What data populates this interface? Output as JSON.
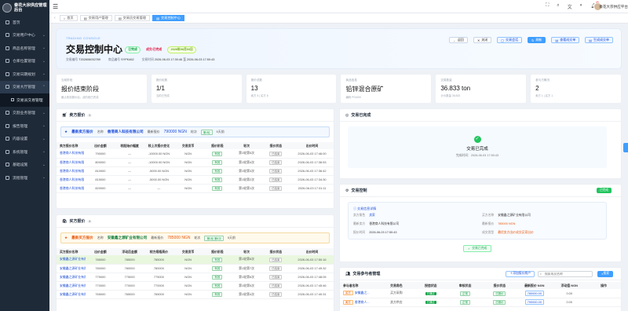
{
  "sidebar": {
    "brand": "秦花大宗供应管理后台",
    "items": [
      {
        "label": "首页",
        "arrow": ""
      },
      {
        "label": "交易用户中心",
        "arrow": "⌄"
      },
      {
        "label": "商品名称管理",
        "arrow": "⌄"
      },
      {
        "label": "仓库位置管理",
        "arrow": "⌄"
      },
      {
        "label": "交易日期规划",
        "arrow": "⌄"
      },
      {
        "label": "交易大厅管理",
        "arrow": "⌃"
      }
    ],
    "sub_item": "交易员交易管理",
    "items2": [
      {
        "label": "交割业务管理",
        "arrow": "⌄"
      },
      {
        "label": "报告管理",
        "arrow": "⌄"
      },
      {
        "label": "内容设置",
        "arrow": "⌄"
      },
      {
        "label": "系统管理",
        "arrow": "⌄"
      },
      {
        "label": "基础设施",
        "arrow": "⌄"
      },
      {
        "label": "流程管理",
        "arrow": "⌄"
      }
    ]
  },
  "topbar": {
    "username": "秦花大宗供应平台",
    "notif_count": "9"
  },
  "tabs": [
    "首页",
    "交易用户管理",
    "交易员交易管理",
    "交易控制中心"
  ],
  "hero": {
    "eyebrow": "TRADING CONSOLE",
    "title": "交易控制中心",
    "status": "已完成",
    "pill2": "成交/已完成",
    "pill3": "2026年06月03日",
    "order_label": "交易编号",
    "order_no": "T202606032789",
    "product_label": "商品编号",
    "product_no": "SYPK462",
    "time_label": "交易时间",
    "time_range": "2026-06-03 17:30:46 至 2026-06-03 17:50:43",
    "actions": [
      "返回",
      "关闭",
      "交易会话",
      "刷新",
      "查看成交单",
      "生成成交单"
    ]
  },
  "stats": [
    {
      "label": "当前阶段",
      "value": "报价结束阶段",
      "sub": "截止收到报价后，此阶段已完成"
    },
    {
      "label": "报价轮数",
      "value": "1/1",
      "sub": "当前已完成"
    },
    {
      "label": "报价总数",
      "value": "13",
      "sub": "卖方 5 | 买方 8"
    },
    {
      "label": "商品信息",
      "value": "铅锌混合原矿",
      "sub": "编码 P01000"
    },
    {
      "label": "交易数量",
      "value": "36.833 ton",
      "sub": "计价数量 36.833"
    },
    {
      "label": "参与方概况",
      "value": "2",
      "sub": "卖方 1 | 买方 1"
    }
  ],
  "sell": {
    "title": "卖方报价",
    "count": "5",
    "banner_tag": "最新卖方报价",
    "banner_name_label": "名称",
    "banner_name": "香港商人科技有限公司",
    "banner_price_label": "最新报价",
    "banner_price": "790000 NGN",
    "banner_round_label": "轮次",
    "banner_round": "第1轮",
    "banner_time": "5天前",
    "cols": [
      "卖方报价名称",
      "出价金额",
      "较起始价幅度",
      "较上次报价变化",
      "交易货币",
      "报价阶段",
      "轮次",
      "报价状态",
      "出价时间"
    ],
    "rows": [
      [
        "香港商人科技有限",
        "790000",
        "—",
        "-10000.00 NGN",
        "NGN",
        "有效",
        "第1轮第5次",
        "已结束",
        "2026-06-03 17:46:00"
      ],
      [
        "香港商人科技有限",
        "800000",
        "—",
        "-10000.00 NGN",
        "NGN",
        "有效",
        "第1轮第4次",
        "已结束",
        "2026-06-03 17:36:53"
      ],
      [
        "香港商人科技有限",
        "810000",
        "—",
        "-5000.00 NGN",
        "NGN",
        "有效",
        "第1轮第3次",
        "已结束",
        "2026-06-03 17:36:42"
      ],
      [
        "香港商人科技有限",
        "815000",
        "—",
        "-5000.00 NGN",
        "NGN",
        "有效",
        "第1轮第2次",
        "已结束",
        "2026-06-03 17:34:30"
      ],
      [
        "香港商人科技有限",
        "820000",
        "—",
        "—",
        "NGN",
        "有效",
        "第1轮第1次",
        "已结束",
        "2026-06-03 17:31:11"
      ]
    ]
  },
  "buy": {
    "title": "买方报价",
    "count": "8",
    "banner_tag": "最新买方报价",
    "banner_name_label": "名称",
    "banner_name": "安徽鑫之源矿业有限公司",
    "banner_price_label": "最新报价",
    "banner_price": "785000 NGN",
    "banner_round_label": "轮次",
    "banner_round": "第1轮 第8次",
    "banner_time": "5天前",
    "cols": [
      "买方报价名称",
      "出价金额",
      "浮动后金额",
      "较方规格高价",
      "交易货币",
      "报价阶段",
      "轮次",
      "报价状态",
      "出价时间"
    ],
    "rows": [
      [
        "安徽鑫之源矿业有限",
        "785000",
        "785000",
        "785000",
        "NGN",
        "有效",
        "第1轮第8次",
        "已结束",
        "2026-06-03 17:50:16"
      ],
      [
        "安徽鑫之源矿业有限",
        "780000",
        "780000",
        "780000",
        "NGN",
        "有效",
        "第1轮第7次",
        "已结束",
        "2026-06-03 17:49:32"
      ],
      [
        "安徽鑫之源矿业有限",
        "775000",
        "775000",
        "775000",
        "NGN",
        "有效",
        "第1轮第6次",
        "已结束",
        "2026-06-03 17:48:05"
      ],
      [
        "安徽鑫之源矿业有限",
        "770000",
        "770000",
        "770000",
        "NGN",
        "有效",
        "第1轮第5次",
        "已结束",
        "2026-06-03 17:45:46"
      ],
      [
        "安徽鑫之源矿业有限",
        "765000",
        "765000",
        "765000",
        "NGN",
        "有效",
        "第1轮第4次",
        "已结束",
        "2026-06-03 17:40:31"
      ]
    ]
  },
  "done": {
    "title": "交易已完成",
    "state": "交易已完成",
    "time_label": "完成时间：",
    "time": "2026-06-03 17:50:43"
  },
  "control": {
    "title": "交易控制",
    "badge": "已完成",
    "box_title": "交易信息详情",
    "kvs": [
      {
        "k": "卖方角色",
        "v": "卖家"
      },
      {
        "k": "买方名称",
        "v": "安徽鑫之源矿业有限公司"
      },
      {
        "k": "最新卖方",
        "v": "香港商人科技有限公司"
      },
      {
        "k": "最新报价",
        "v": "785000 NGN"
      },
      {
        "k": "报价时间",
        "v": "2026-06-03 17:50:43"
      },
      {
        "k": "成交类型",
        "v": "最优卖方出价成交买家出价"
      }
    ],
    "button": "交易已完成"
  },
  "participants": {
    "title": "交易参与者管理",
    "add_btn": "添加报价商户",
    "search_placeholder": "搜索成员名称",
    "search_btn": "搜索",
    "cols": [
      "参与者名称",
      "交易角色",
      "授信状态",
      "审核状态",
      "报价状态",
      "最新报价 NGN",
      "浮动值 NGN",
      "操作"
    ],
    "rows": [
      [
        "买方",
        "安徽鑫之...",
        "买方采购",
        "已通过",
        "正常",
        "已报价",
        "780000.00",
        "0.00"
      ],
      [
        "卖方",
        "香港商人...",
        "卖方供应",
        "已通过",
        "正常",
        "已报价",
        "790000.00",
        "0.00"
      ]
    ]
  },
  "colors": {
    "accent": "#409eff",
    "sidebar": "#1f2a38",
    "success": "#16a34a"
  }
}
